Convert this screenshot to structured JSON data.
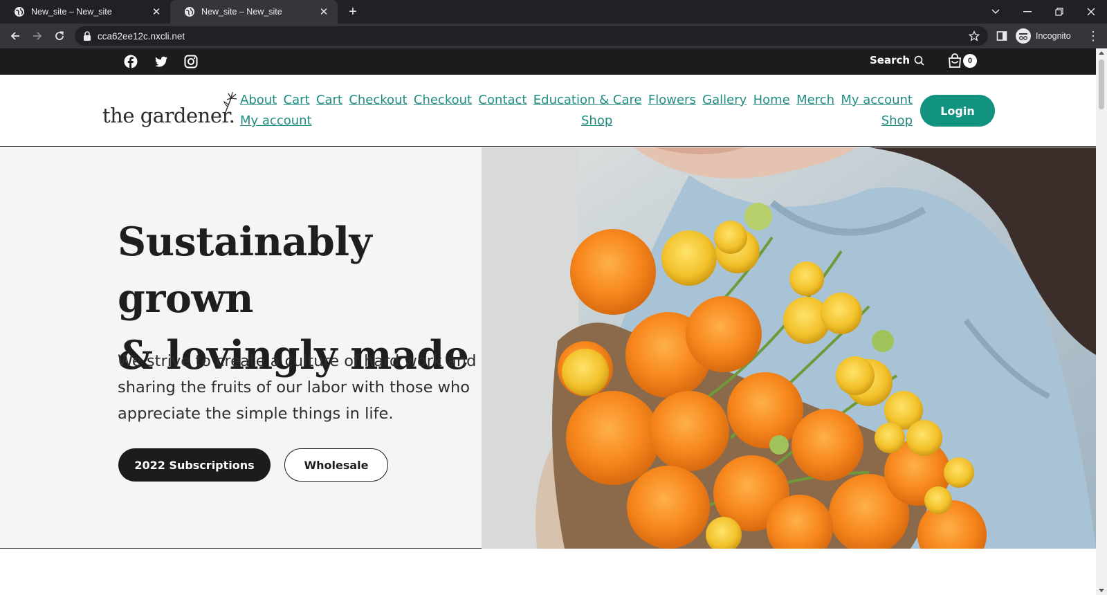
{
  "browser": {
    "tabs": [
      {
        "title": "New_site – New_site",
        "active": false
      },
      {
        "title": "New_site – New_site",
        "active": true
      }
    ],
    "url": "cca62ee12c.nxcli.net",
    "profile_label": "Incognito"
  },
  "topbar": {
    "social": [
      "facebook-icon",
      "twitter-icon",
      "instagram-icon"
    ],
    "search_label": "Search",
    "cart_count": "0"
  },
  "header": {
    "logo_text": "the gardener.",
    "nav": {
      "row1": [
        "About",
        "Cart",
        "Cart",
        "Checkout",
        "Checkout",
        "Contact",
        "Education & Care",
        "Flowers",
        "Gallery",
        "Home",
        "Merch",
        "My account"
      ],
      "row2": [
        "My account",
        "Shop",
        "Shop"
      ]
    },
    "login_label": "Login"
  },
  "hero": {
    "title_line1": "Sustainably grown",
    "title_line2": "& lovingly made",
    "subtitle": "We strive to create a culture of hard work and sharing the fruits of our labor with those who appreciate the simple things in life.",
    "primary_button": "2022 Subscriptions",
    "secondary_button": "Wholesale"
  },
  "colors": {
    "accent": "#12937f",
    "link": "#1f8c7f",
    "dark": "#1c1c1c",
    "hero_bg": "#f5f5f4"
  }
}
